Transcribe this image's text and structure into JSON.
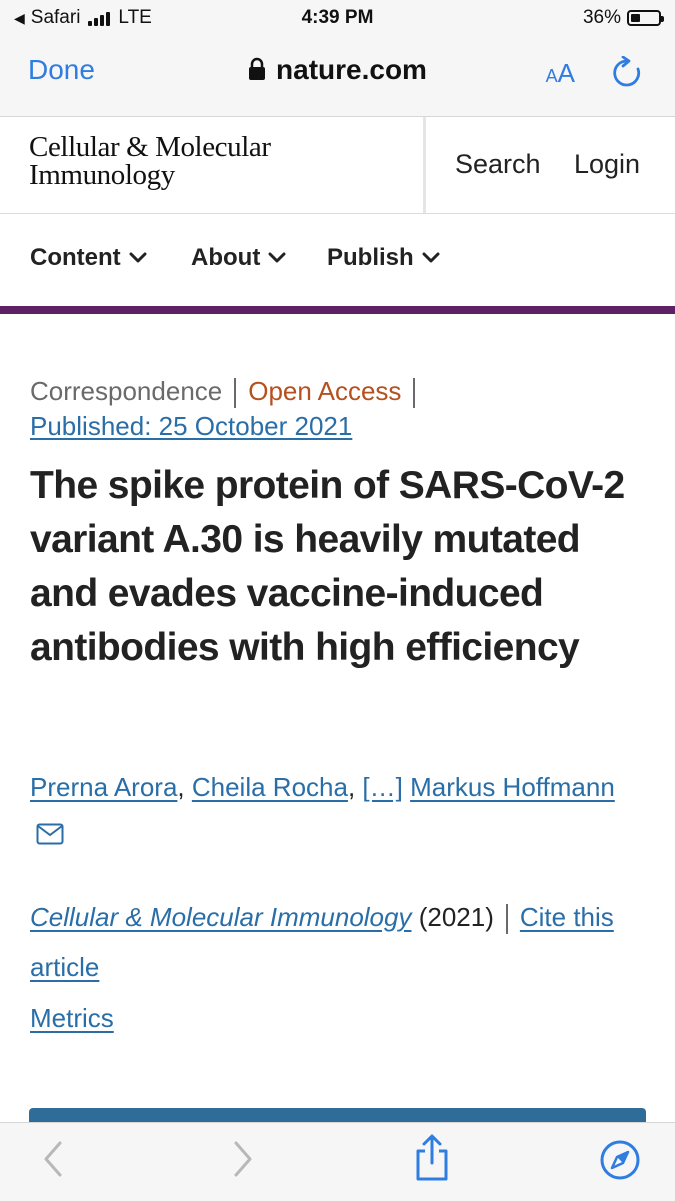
{
  "status_bar": {
    "carrier": "Safari",
    "network": "LTE",
    "time": "4:39 PM",
    "battery": "36%",
    "battery_level": 0.36
  },
  "safari": {
    "done_label": "Done",
    "url": "nature.com",
    "text_size_label": "AA"
  },
  "site": {
    "logo_line1": "Cellular & Molecular",
    "logo_line2": "Immunology",
    "search_label": "Search",
    "login_label": "Login",
    "accent_color": "#5e2163"
  },
  "nav": {
    "items": [
      {
        "label": "Content"
      },
      {
        "label": "About"
      },
      {
        "label": "Publish"
      }
    ]
  },
  "article": {
    "type": "Correspondence",
    "access": "Open Access",
    "published": "Published: 25 October 2021",
    "title": "The spike protein of SARS-CoV-2 variant A.30 is heavily mutated and evades vaccine-induced antibodies with high efficiency",
    "authors": [
      "Prerna Arora",
      "Cheila Rocha",
      "[…]",
      "Markus Hoffmann"
    ],
    "author_sep": ", ",
    "journal": "Cellular & Molecular Immunology",
    "year": "(2021)",
    "cite_label": "Cite this article",
    "metrics_label": "Metrics"
  },
  "icons": {
    "lock": "lock-icon",
    "reload": "reload-icon",
    "mail": "mail-icon",
    "back": "chevron-left-icon",
    "forward": "chevron-right-icon",
    "share": "share-icon",
    "compass": "compass-icon",
    "chevron": "chevron-down-icon"
  }
}
